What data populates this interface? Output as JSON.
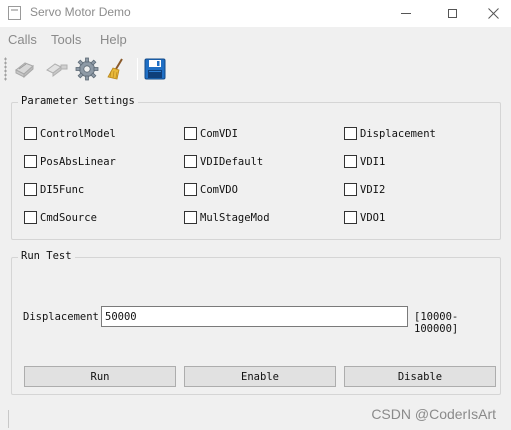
{
  "window": {
    "title": "Servo Motor Demo",
    "icon": "application-window-icon"
  },
  "menu": {
    "items": [
      {
        "label": "Calls"
      },
      {
        "label": "Tools"
      },
      {
        "label": "Help"
      }
    ]
  },
  "toolbar": {
    "buttons": [
      {
        "icon": "connect-icon"
      },
      {
        "icon": "disconnect-icon"
      },
      {
        "icon": "settings-gear-icon"
      },
      {
        "icon": "clear-broom-icon"
      },
      {
        "icon": "save-floppy-icon"
      }
    ]
  },
  "parameter_settings": {
    "title": "Parameter Settings",
    "checkboxes": [
      {
        "label": "ControlModel",
        "checked": false
      },
      {
        "label": "ComVDI",
        "checked": false
      },
      {
        "label": "Displacement",
        "checked": false
      },
      {
        "label": "PosAbsLinear",
        "checked": false
      },
      {
        "label": "VDIDefault",
        "checked": false
      },
      {
        "label": "VDI1",
        "checked": false
      },
      {
        "label": "DI5Func",
        "checked": false
      },
      {
        "label": "ComVDO",
        "checked": false
      },
      {
        "label": "VDI2",
        "checked": false
      },
      {
        "label": "CmdSource",
        "checked": false
      },
      {
        "label": "MulStageMod",
        "checked": false
      },
      {
        "label": "VDO1",
        "checked": false
      }
    ]
  },
  "run_test": {
    "title": "Run Test",
    "displacement_label": "Displacement",
    "displacement_value": "50000",
    "range_hint": "[10000-100000]",
    "buttons": {
      "run": "Run",
      "enable": "Enable",
      "disable": "Disable"
    }
  },
  "status": {
    "watermark": "CSDN @CoderIsArt"
  },
  "colors": {
    "window_bg": "#f0f0f0",
    "disabled_text": "#8a8a8a",
    "toolbar_save_blue": "#1f6fc5"
  }
}
